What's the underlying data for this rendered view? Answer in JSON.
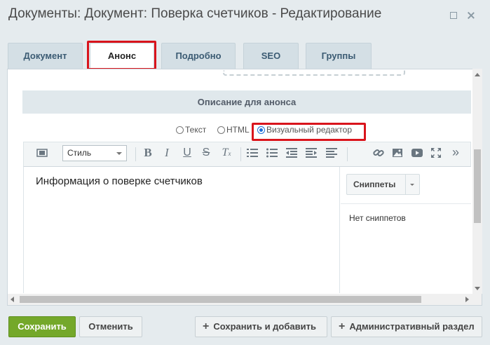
{
  "window": {
    "title": "Документы: Документ: Поверка счетчиков - Редактирование",
    "maximize_icon": "maximize-icon",
    "close_icon": "close-icon"
  },
  "tabs": [
    {
      "label": "Документ",
      "active": false
    },
    {
      "label": "Анонс",
      "active": true
    },
    {
      "label": "Подробно",
      "active": false
    },
    {
      "label": "SEO",
      "active": false
    },
    {
      "label": "Группы",
      "active": false
    }
  ],
  "section": {
    "title": "Описание для анонса"
  },
  "format_options": [
    {
      "label": "Текст",
      "selected": false
    },
    {
      "label": "HTML",
      "selected": false
    },
    {
      "label": "Визуальный редактор",
      "selected": true
    }
  ],
  "toolbar": {
    "style_select_value": "Стиль",
    "icons": [
      "source-toggle-icon",
      "bold-icon",
      "italic-icon",
      "underline-icon",
      "strikethrough-icon",
      "remove-format-icon",
      "ordered-list-icon",
      "unordered-list-icon",
      "outdent-icon",
      "indent-icon",
      "link-icon",
      "image-icon",
      "video-icon",
      "fullscreen-icon",
      "more-icon"
    ]
  },
  "editor": {
    "content": "Информация о поверке счетчиков"
  },
  "snippets": {
    "button_label": "Сниппеты",
    "empty_text": "Нет сниппетов"
  },
  "footer": {
    "save_label": "Сохранить",
    "cancel_label": "Отменить",
    "save_add_label": "Сохранить и добавить",
    "admin_section_label": "Административный раздел"
  },
  "colors": {
    "highlight": "#d9141c",
    "save_button": "#74a82a",
    "tab_inactive": "#d4dfe5"
  }
}
